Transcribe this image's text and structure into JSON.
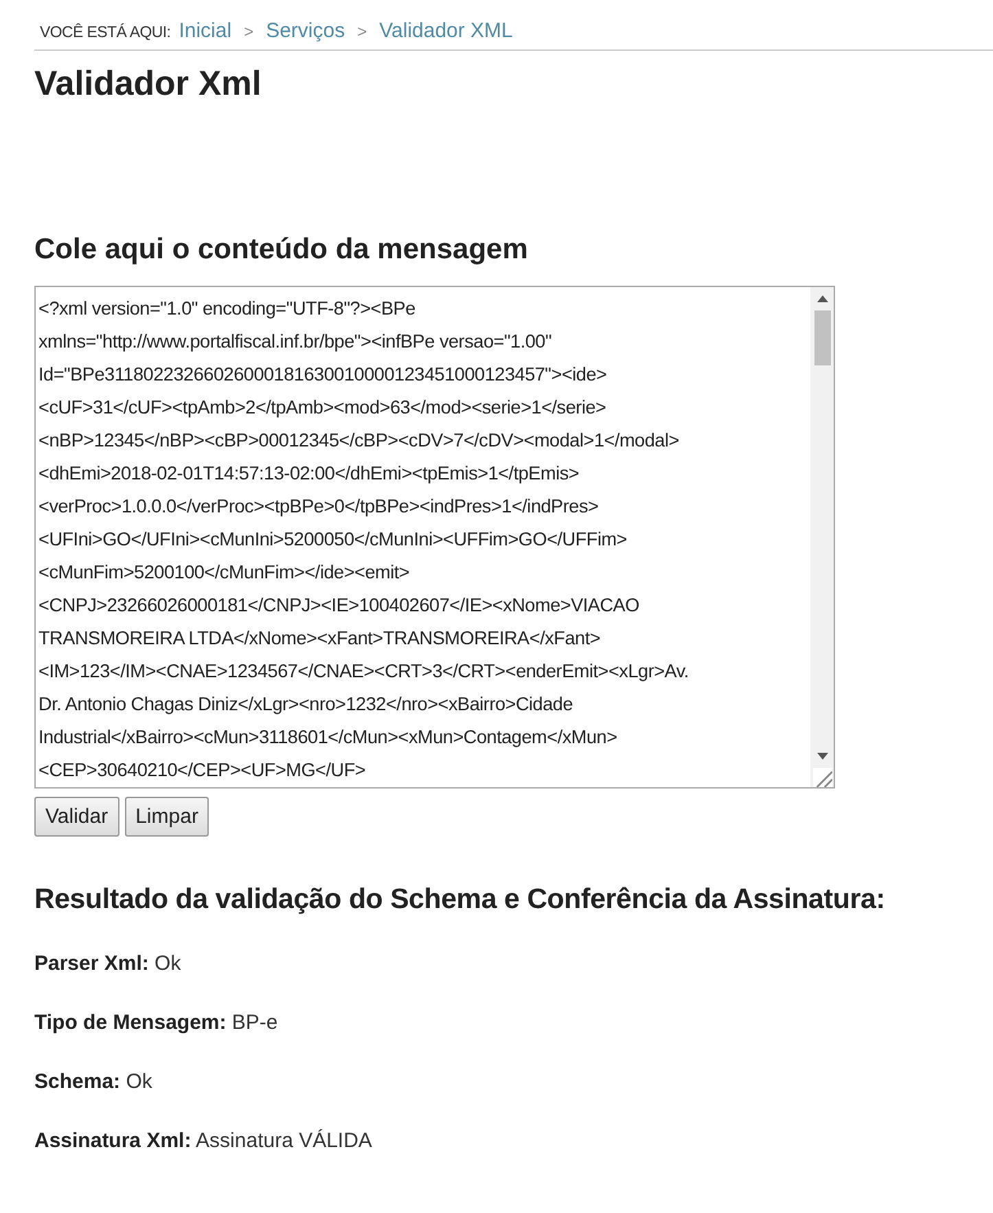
{
  "breadcrumb": {
    "label": "VOCÊ ESTÁ AQUI:",
    "items": [
      {
        "text": "Inicial"
      },
      {
        "text": "Serviços"
      },
      {
        "text": "Validador XML"
      }
    ],
    "separator": ">"
  },
  "title": "Validador Xml",
  "input_heading": "Cole aqui o conteúdo da mensagem",
  "message_field": {
    "lines": [
      "<?xml version=\"1.0\" encoding=\"UTF-8\"?><BPe",
      "xmlns=\"http://www.portalfiscal.inf.br/bpe\"><infBPe versao=\"1.00\"",
      "Id=\"BPe31180223266026000181630010000123451000123457\"><ide>",
      "<cUF>31</cUF><tpAmb>2</tpAmb><mod>63</mod><serie>1</serie>",
      "<nBP>12345</nBP><cBP>00012345</cBP><cDV>7</cDV><modal>1</modal>",
      "<dhEmi>2018-02-01T14:57:13-02:00</dhEmi><tpEmis>1</tpEmis>",
      "<verProc>1.0.0.0</verProc><tpBPe>0</tpBPe><indPres>1</indPres>",
      "<UFIni>GO</UFIni><cMunIni>5200050</cMunIni><UFFim>GO</UFFim>",
      "<cMunFim>5200100</cMunFim></ide><emit>",
      "<CNPJ>23266026000181</CNPJ><IE>100402607</IE><xNome>VIACAO",
      "TRANSMOREIRA LTDA</xNome><xFant>TRANSMOREIRA</xFant>",
      "<IM>123</IM><CNAE>1234567</CNAE><CRT>3</CRT><enderEmit><xLgr>Av.",
      "Dr. Antonio Chagas Diniz</xLgr><nro>1232</nro><xBairro>Cidade",
      "Industrial</xBairro><cMun>3118601</cMun><xMun>Contagem</xMun>",
      "<CEP>30640210</CEP><UF>MG</UF>"
    ]
  },
  "buttons": [
    {
      "label": "Validar"
    },
    {
      "label": "Limpar"
    }
  ],
  "result_heading": "Resultado da validação do Schema e Conferência da Assinatura:",
  "results": [
    {
      "label": "Parser Xml:",
      "value": "Ok"
    },
    {
      "label": "Tipo de Mensagem:",
      "value": "BP-e"
    },
    {
      "label": "Schema:",
      "value": "Ok"
    },
    {
      "label": "Assinatura Xml:",
      "value": "Assinatura VÁLIDA"
    }
  ]
}
